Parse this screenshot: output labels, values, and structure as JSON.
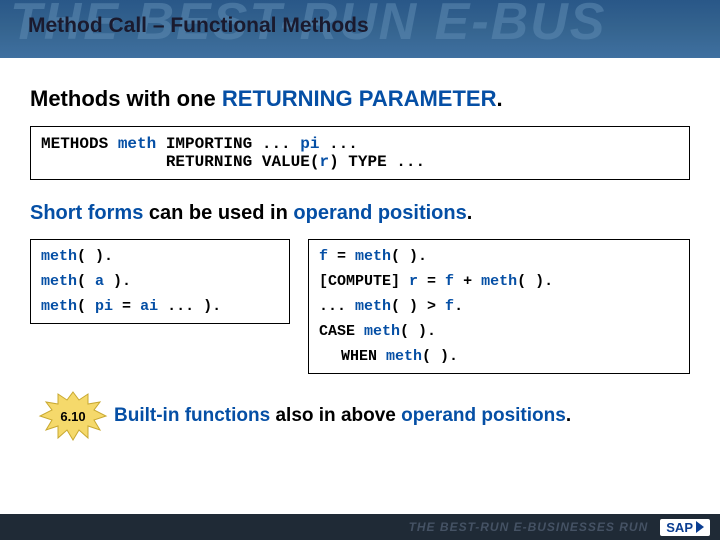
{
  "header": {
    "ghost": "THE BEST-RUN E-BUS",
    "title": "Method Call – Functional Methods"
  },
  "heading1_a": "Methods with one ",
  "heading1_b": "RETURNING PARAMETER",
  "heading1_c": ".",
  "codebox1": {
    "line1_a": "METHODS ",
    "line1_b": "meth",
    "line1_c": " IMPORTING ... ",
    "line1_d": "pi",
    "line1_e": " ...",
    "line2_a": "             RETURNING VALUE(",
    "line2_b": "r",
    "line2_c": ") TYPE ..."
  },
  "heading2_a": "Short forms",
  "heading2_b": " can be used in ",
  "heading2_c": "operand positions",
  "heading2_d": ".",
  "left": {
    "l1_a": "meth",
    "l1_b": "( ).",
    "l2_a": "meth",
    "l2_b": "( ",
    "l2_c": "a",
    "l2_d": " ).",
    "l3_a": "meth",
    "l3_b": "( ",
    "l3_c": "pi",
    "l3_d": " = ",
    "l3_e": "ai",
    "l3_f": " ... )."
  },
  "right": {
    "r1_a": "f",
    "r1_b": " = ",
    "r1_c": "meth",
    "r1_d": "( ).",
    "r2_a": "[COMPUTE] ",
    "r2_b": "r",
    "r2_c": " = ",
    "r2_d": "f",
    "r2_e": " + ",
    "r2_f": "meth",
    "r2_g": "( ).",
    "r3_a": "... ",
    "r3_b": "meth",
    "r3_c": "( ) > ",
    "r3_d": "f",
    "r3_e": ".",
    "r4_a": "CASE ",
    "r4_b": "meth",
    "r4_c": "( ).",
    "r5_a": "WHEN ",
    "r5_b": "meth",
    "r5_c": "( )."
  },
  "badge": "6.10",
  "bottom_a": "Built-in functions",
  "bottom_b": " also in above ",
  "bottom_c": "operand positions",
  "bottom_d": ".",
  "footer": {
    "ghost": "THE BEST-RUN E-BUSINESSES RUN",
    "logo": "SAP"
  }
}
